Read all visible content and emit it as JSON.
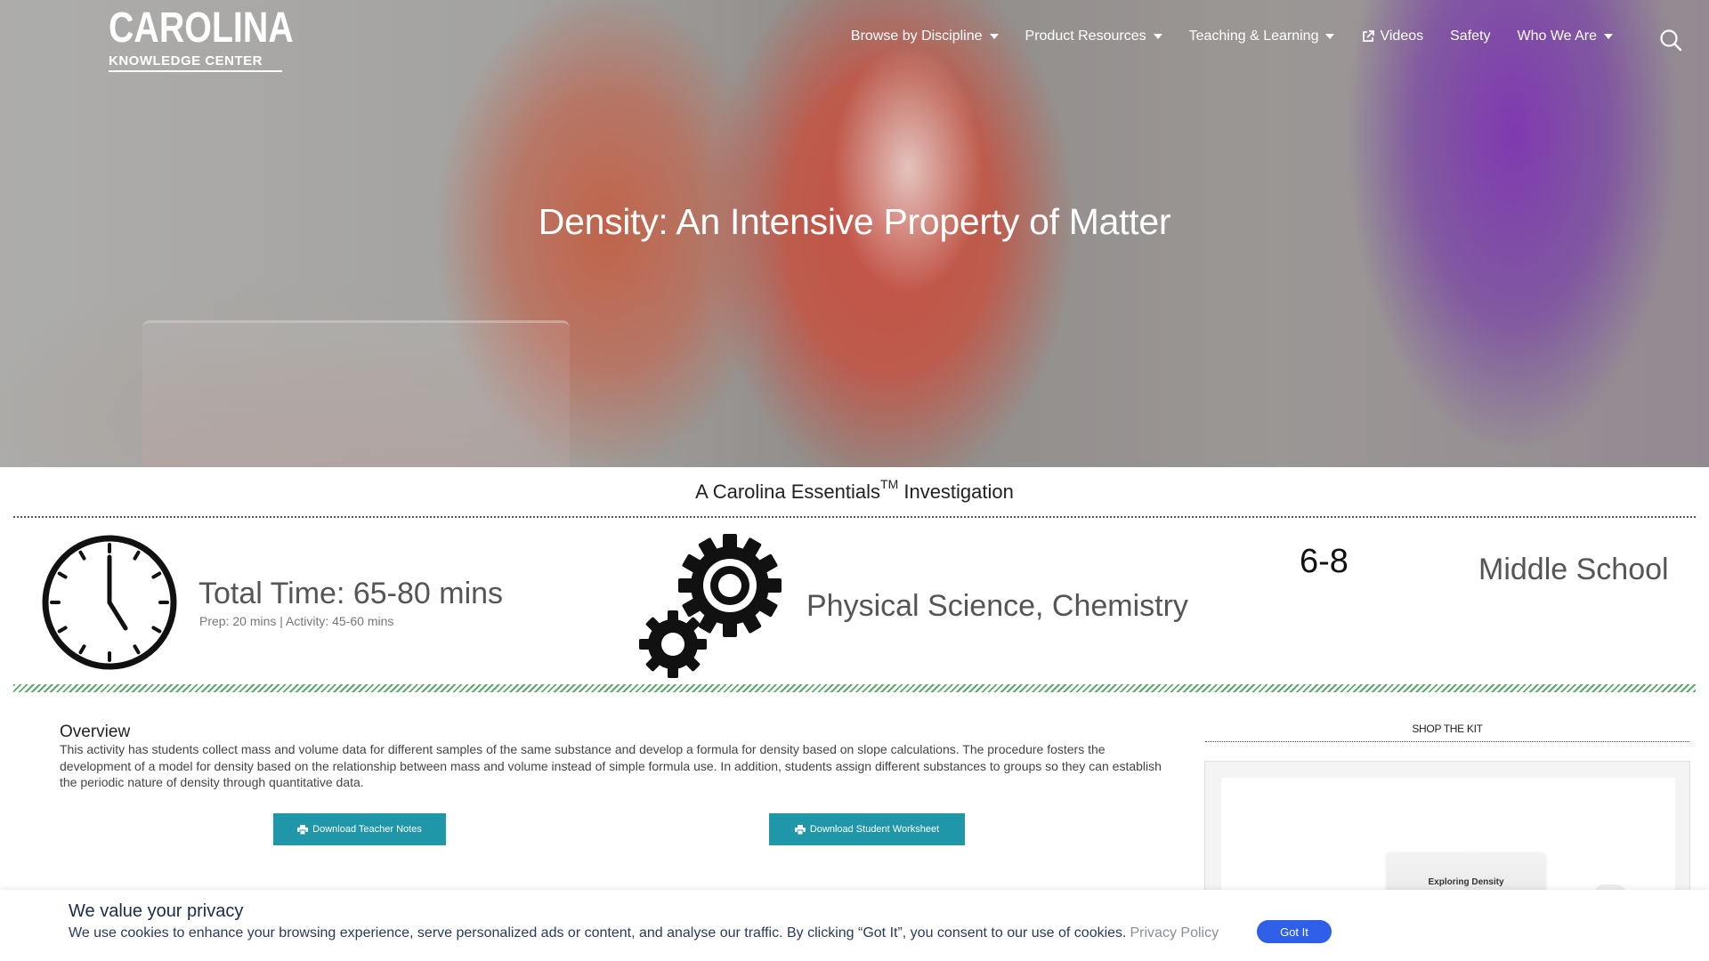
{
  "header": {
    "logo_main": "CAROLINA",
    "logo_sub": "KNOWLEDGE CENTER",
    "nav": [
      {
        "label": "Browse by Discipline"
      },
      {
        "label": "Product Resources"
      },
      {
        "label": "Teaching & Learning"
      },
      {
        "label": "Videos"
      },
      {
        "label": "Safety"
      },
      {
        "label": "Who We Are"
      }
    ]
  },
  "hero": {
    "title": "Density: An Intensive Property of Matter"
  },
  "subheading": {
    "prefix": "A Carolina Essentials",
    "tm": "TM",
    "suffix": " Investigation"
  },
  "info": {
    "total_time": "Total Time: 65-80 mins",
    "time_breakdown": "Prep: 20 mins | Activity: 45-60 mins",
    "subject": "Physical Science, Chemistry",
    "grade_range": "6-8",
    "grade_level": "Middle School"
  },
  "overview": {
    "title": "Overview",
    "text": "This activity has students collect mass and volume data for different samples of the same substance and develop a formula for density based on slope calculations. The procedure fosters the development of a model for density based on the relationship between mass and volume instead of simple formula use. In addition, students assign different substances to groups so they can establish the periodic nature of density through quantitative data.",
    "btn_teacher": "Download Teacher Notes",
    "btn_student": "Download Student Worksheet"
  },
  "shop": {
    "title": "SHOP THE KIT",
    "kit_label": "Exploring Density"
  },
  "cookie": {
    "title": "We value your privacy",
    "text": "We use cookies to enhance your browsing experience, serve personalized ads or content, and analyse our traffic. By clicking “Got It”, you consent to our use of cookies.",
    "link": "Privacy Policy",
    "button": "Got It"
  },
  "colors": {
    "button_teal": "#1f97a8",
    "cookie_button": "#2f5fe6",
    "divider_green": "#5aa86a"
  }
}
